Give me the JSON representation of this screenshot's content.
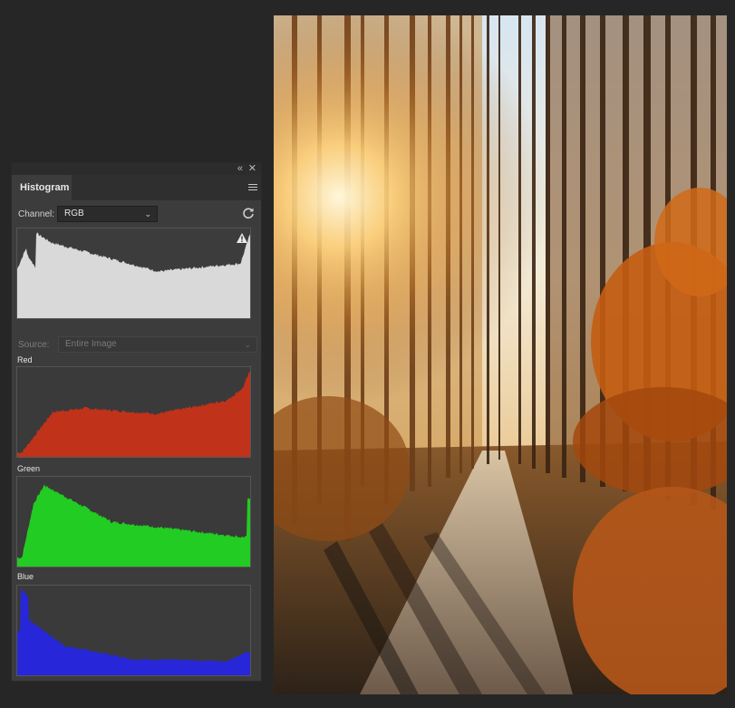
{
  "panel": {
    "collapse_icon": "double-chevron-left-icon",
    "close_icon": "close-icon",
    "tab_label": "Histogram",
    "menu_icon": "panel-menu-icon",
    "channel_label": "Channel:",
    "channel_value": "RGB",
    "refresh_icon": "refresh-icon",
    "warning_icon": "cache-warning-icon",
    "source_label": "Source:",
    "source_value": "Entire Image",
    "red_label": "Red",
    "green_label": "Green",
    "blue_label": "Blue"
  },
  "colors": {
    "rgb_fill": "#d9d9d9",
    "red_fill": "#c0321a",
    "green_fill": "#22cc22",
    "blue_fill": "#2727d9"
  },
  "photo": {
    "subject": "sunlit autumn forest road"
  }
}
